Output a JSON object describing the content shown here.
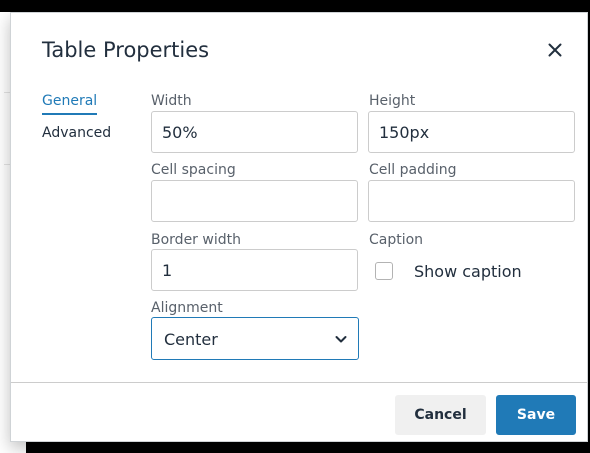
{
  "dialog": {
    "title": "Table Properties",
    "close_icon": "close-icon"
  },
  "tabs": [
    {
      "label": "General",
      "active": true
    },
    {
      "label": "Advanced",
      "active": false
    }
  ],
  "fields": {
    "width": {
      "label": "Width",
      "value": "50%"
    },
    "height": {
      "label": "Height",
      "value": "150px"
    },
    "cell_spacing": {
      "label": "Cell spacing",
      "value": ""
    },
    "cell_padding": {
      "label": "Cell padding",
      "value": ""
    },
    "border_width": {
      "label": "Border width",
      "value": "1"
    },
    "caption": {
      "label": "Caption",
      "checkbox_label": "Show caption",
      "checked": false
    },
    "alignment": {
      "label": "Alignment",
      "selected": "Center",
      "icon": "chevron-down-icon"
    }
  },
  "footer": {
    "cancel_label": "Cancel",
    "save_label": "Save"
  },
  "colors": {
    "accent": "#207ab7",
    "text": "#222f3e",
    "label": "#59616b",
    "border": "#cccccc"
  }
}
